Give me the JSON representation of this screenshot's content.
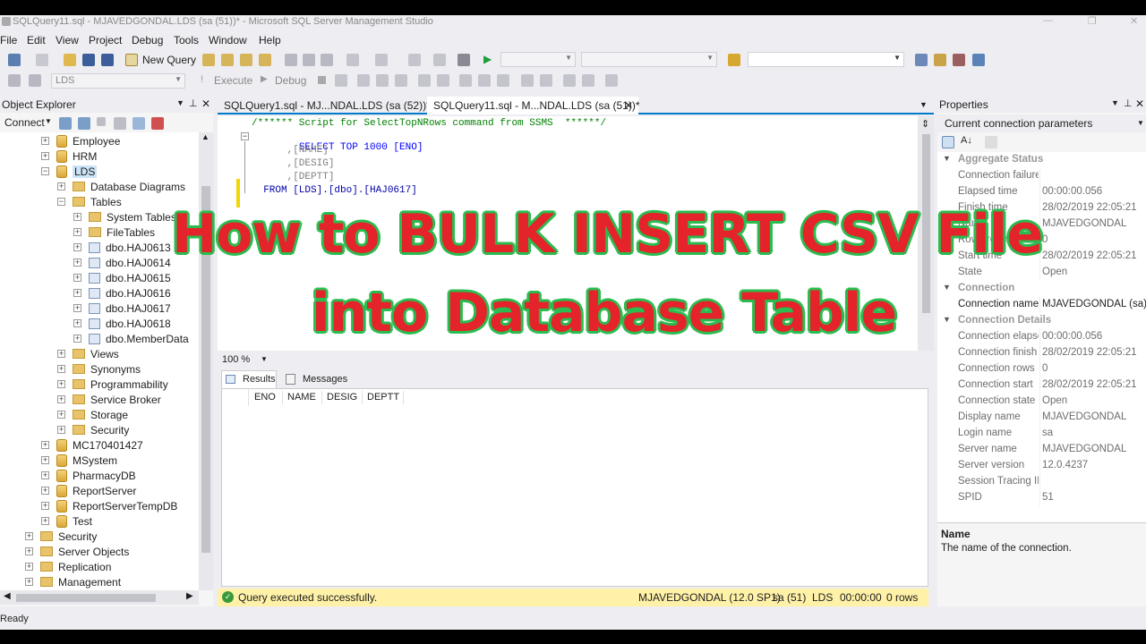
{
  "window": {
    "title": "SQLQuery11.sql - MJAVEDGONDAL.LDS (sa (51))* - Microsoft SQL Server Management Studio",
    "status": "Ready"
  },
  "menu": [
    "File",
    "Edit",
    "View",
    "Project",
    "Debug",
    "Tools",
    "Window",
    "Help"
  ],
  "toolbar": {
    "new_query": "New Query",
    "db_combo": "LDS",
    "execute": "Execute",
    "debug": "Debug"
  },
  "object_explorer": {
    "title": "Object Explorer",
    "connect": "Connect",
    "items": [
      {
        "label": "Employee",
        "kind": "db",
        "level": 1,
        "exp": "+"
      },
      {
        "label": "HRM",
        "kind": "db",
        "level": 1,
        "exp": "+"
      },
      {
        "label": "LDS",
        "kind": "db",
        "level": 1,
        "exp": "−",
        "selected": true
      },
      {
        "label": "Database Diagrams",
        "kind": "folder",
        "level": 2,
        "exp": "+"
      },
      {
        "label": "Tables",
        "kind": "folder",
        "level": 2,
        "exp": "−"
      },
      {
        "label": "System Tables",
        "kind": "folder",
        "level": 3,
        "exp": "+"
      },
      {
        "label": "FileTables",
        "kind": "folder",
        "level": 3,
        "exp": "+"
      },
      {
        "label": "dbo.HAJ0613",
        "kind": "table",
        "level": 3,
        "exp": "+"
      },
      {
        "label": "dbo.HAJ0614",
        "kind": "table",
        "level": 3,
        "exp": "+"
      },
      {
        "label": "dbo.HAJ0615",
        "kind": "table",
        "level": 3,
        "exp": "+"
      },
      {
        "label": "dbo.HAJ0616",
        "kind": "table",
        "level": 3,
        "exp": "+"
      },
      {
        "label": "dbo.HAJ0617",
        "kind": "table",
        "level": 3,
        "exp": "+"
      },
      {
        "label": "dbo.HAJ0618",
        "kind": "table",
        "level": 3,
        "exp": "+"
      },
      {
        "label": "dbo.MemberData",
        "kind": "table",
        "level": 3,
        "exp": "+"
      },
      {
        "label": "Views",
        "kind": "folder",
        "level": 2,
        "exp": "+"
      },
      {
        "label": "Synonyms",
        "kind": "folder",
        "level": 2,
        "exp": "+"
      },
      {
        "label": "Programmability",
        "kind": "folder",
        "level": 2,
        "exp": "+"
      },
      {
        "label": "Service Broker",
        "kind": "folder",
        "level": 2,
        "exp": "+"
      },
      {
        "label": "Storage",
        "kind": "folder",
        "level": 2,
        "exp": "+"
      },
      {
        "label": "Security",
        "kind": "folder",
        "level": 2,
        "exp": "+"
      },
      {
        "label": "MC170401427",
        "kind": "db",
        "level": 1,
        "exp": "+"
      },
      {
        "label": "MSystem",
        "kind": "db",
        "level": 1,
        "exp": "+"
      },
      {
        "label": "PharmacyDB",
        "kind": "db",
        "level": 1,
        "exp": "+"
      },
      {
        "label": "ReportServer",
        "kind": "db",
        "level": 1,
        "exp": "+"
      },
      {
        "label": "ReportServerTempDB",
        "kind": "db",
        "level": 1,
        "exp": "+"
      },
      {
        "label": "Test",
        "kind": "db",
        "level": 1,
        "exp": "+"
      },
      {
        "label": "Security",
        "kind": "folder",
        "level": 0,
        "exp": "+"
      },
      {
        "label": "Server Objects",
        "kind": "folder",
        "level": 0,
        "exp": "+"
      },
      {
        "label": "Replication",
        "kind": "folder",
        "level": 0,
        "exp": "+"
      },
      {
        "label": "Management",
        "kind": "folder",
        "level": 0,
        "exp": "+"
      }
    ]
  },
  "tabs": [
    {
      "label": "SQLQuery1.sql - MJ...NDAL.LDS (sa (52))*",
      "active": false
    },
    {
      "label": "SQLQuery11.sql - M...NDAL.LDS (sa (51))*",
      "active": true
    }
  ],
  "editor": {
    "lines": [
      "/****** Script for SelectTopNRows command from SSMS  ******/",
      "SELECT TOP 1000 [ENO]",
      "      ,[NAME]",
      "      ,[DESIG]",
      "      ,[DEPTT]",
      "  FROM [LDS].[dbo].[HAJ0617]"
    ],
    "zoom": "100 %"
  },
  "results": {
    "tab_results": "Results",
    "tab_messages": "Messages",
    "columns": [
      "ENO",
      "NAME",
      "DESIG",
      "DEPTT"
    ]
  },
  "query_status": {
    "message": "Query executed successfully.",
    "server": "MJAVEDGONDAL (12.0 SP1)",
    "user": "sa (51)",
    "db": "LDS",
    "time": "00:00:00",
    "rows": "0 rows"
  },
  "properties": {
    "title": "Properties",
    "object": "Current connection parameters",
    "rows": [
      {
        "cat": true,
        "k": "Aggregate Status"
      },
      {
        "k": "Connection failure",
        "v": ""
      },
      {
        "k": "Elapsed time",
        "v": "00:00:00.056"
      },
      {
        "k": "Finish time",
        "v": "28/02/2019 22:05:21"
      },
      {
        "k": "Name",
        "v": "MJAVEDGONDAL"
      },
      {
        "k": "Rows returned",
        "v": "0"
      },
      {
        "k": "Start time",
        "v": "28/02/2019 22:05:21"
      },
      {
        "k": "State",
        "v": "Open"
      },
      {
        "cat": true,
        "k": "Connection"
      },
      {
        "k": "Connection name",
        "v": "MJAVEDGONDAL (sa)",
        "dark": true
      },
      {
        "cat": true,
        "k": "Connection Details"
      },
      {
        "k": "Connection elapsed",
        "v": "00:00:00.056"
      },
      {
        "k": "Connection finish",
        "v": "28/02/2019 22:05:21"
      },
      {
        "k": "Connection rows",
        "v": "0"
      },
      {
        "k": "Connection start",
        "v": "28/02/2019 22:05:21"
      },
      {
        "k": "Connection state",
        "v": "Open"
      },
      {
        "k": "Display name",
        "v": "MJAVEDGONDAL"
      },
      {
        "k": "Login name",
        "v": "sa"
      },
      {
        "k": "Server name",
        "v": "MJAVEDGONDAL"
      },
      {
        "k": "Server version",
        "v": "12.0.4237"
      },
      {
        "k": "Session Tracing ID",
        "v": ""
      },
      {
        "k": "SPID",
        "v": "51"
      }
    ],
    "desc_title": "Name",
    "desc_text": "The name of the connection."
  },
  "overlay": {
    "line1": "How to BULK INSERT CSV File",
    "line2": "into Database Table"
  },
  "colors": {
    "overlay_fill": "#e4232a",
    "overlay_outline": "#2bbc4f",
    "chrome": "#eeeef2",
    "selected": "#cce4f7"
  }
}
